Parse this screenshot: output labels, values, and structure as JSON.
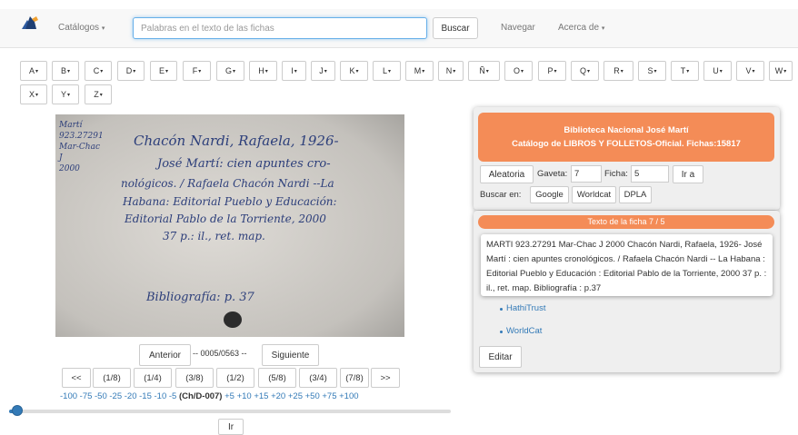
{
  "navbar": {
    "catalogos": "Catálogos",
    "search_placeholder": "Palabras en el texto de las fichas",
    "search_button": "Buscar",
    "navegar": "Navegar",
    "acerca": "Acerca de"
  },
  "letters": [
    "A",
    "B",
    "C",
    "D",
    "E",
    "F",
    "G",
    "H",
    "I",
    "J",
    "K",
    "L",
    "M",
    "N",
    "Ñ",
    "O",
    "P",
    "Q",
    "R",
    "S",
    "T",
    "U",
    "V",
    "W",
    "X",
    "Y",
    "Z"
  ],
  "card_handwriting": {
    "line1": "Chacón Nardi, Rafaela, 1926-",
    "line2": "José Martí: cien apuntes cro-",
    "line3": "nológicos. / Rafaela Chacón Nardi --La",
    "line4": "Habana: Editorial Pueblo y Educación:",
    "line5": "Editorial Pablo de la Torriente, 2000",
    "line6": "37 p.: il., ret. map.",
    "margin1": "Martí",
    "margin2": "923.27291",
    "margin3": "Mar-Chac",
    "margin4": "J",
    "margin5": "2000",
    "bib": "Bibliografía: p. 37"
  },
  "pager": {
    "anterior": "Anterior",
    "counter": "-- 0005/0563 --",
    "siguiente": "Siguiente",
    "fractions": [
      "<<",
      "(1/8)",
      "(1/4)",
      "(3/8)",
      "(1/2)",
      "(5/8)",
      "(3/4)",
      "(7/8)",
      ">>"
    ],
    "offsets_neg": "-100 -75 -50 -25 -20 -15 -10 -5",
    "current": "(Ch/D-007)",
    "offsets_pos": "+5 +10 +15 +20 +25 +50 +75 +100",
    "ir": "Ir",
    "slider_position": 0.01
  },
  "catalog_panel": {
    "line1": "Biblioteca Nacional José Martí",
    "line2": "Catálogo de LIBROS Y FOLLETOS-Oficial. Fichas:15817",
    "aleatoria": "Aleatoria",
    "gaveta_label": "Gaveta:",
    "gaveta_value": "7",
    "ficha_label": "Ficha:",
    "ficha_value": "5",
    "ir_a": "Ir a",
    "buscar_en": "Buscar en:",
    "google": "Google",
    "worldcat": "Worldcat",
    "dpla": "DPLA"
  },
  "text_panel": {
    "header": "Texto de la ficha 7 / 5",
    "record_text": "MARTI 923.27291 Mar-Chac J 2000 Chacón Nardi, Rafaela, 1926- José Martí : cien apuntes cronológicos. / Rafaela Chacón Nardi -- La Habana : Editorial Pueblo y Educación : Editorial Pablo de la Torriente, 2000 37 p. : il., ret. map. Bibliografía : p.37",
    "link1": "HathiTrust",
    "link2": "WorldCat",
    "editar": "Editar"
  },
  "colors": {
    "accent": "#f48c57",
    "link": "#337ab7"
  }
}
